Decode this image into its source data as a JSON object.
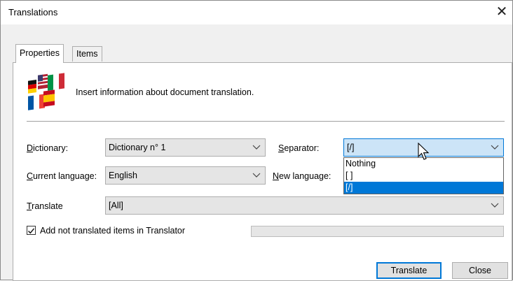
{
  "window": {
    "title": "Translations",
    "close_glyph": "✕"
  },
  "tabs": [
    {
      "label": "Properties",
      "active": true
    },
    {
      "label": "Items",
      "active": false
    }
  ],
  "header": {
    "icon": "flags-icon",
    "info_text": "Insert information about document translation."
  },
  "fields": {
    "dictionary": {
      "label_ul": "D",
      "label_rest": "ictionary:",
      "value": "Dictionary n° 1"
    },
    "separator": {
      "label_ul": "S",
      "label_rest": "eparator:",
      "value": "[/]",
      "options": [
        "Nothing",
        "[ ]",
        "[/]"
      ],
      "selected": "[/]"
    },
    "current_language": {
      "label_ul": "C",
      "label_rest": "urrent language:",
      "value": "English"
    },
    "new_language": {
      "label_ul": "N",
      "label_rest": "ew language:",
      "value": ""
    },
    "translate": {
      "label_ul": "T",
      "label_rest": "ranslate",
      "value": "[All]"
    }
  },
  "checkbox": {
    "label": "Add not translated items in Translator",
    "checked": true
  },
  "progress": {
    "value": 0
  },
  "buttons": {
    "translate": "Translate",
    "close": "Close"
  },
  "colors": {
    "accent": "#0078d7",
    "focus_bg": "#cce4f7",
    "panel_bg": "#ffffff",
    "window_bg": "#f0f0f0"
  }
}
